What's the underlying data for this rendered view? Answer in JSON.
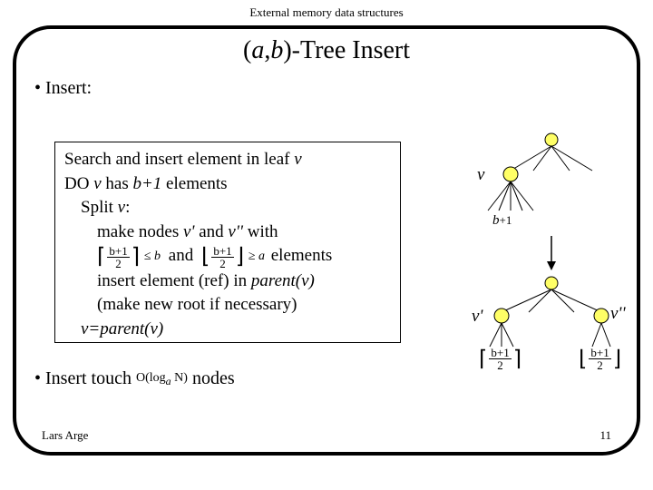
{
  "header": "External memory data structures",
  "title_pre": "(",
  "title_a": "a",
  "title_sep": ",",
  "title_b": "b",
  "title_post": ")-Tree Insert",
  "bullet_insert": "Insert:",
  "box": {
    "l1a": "Search and insert element in leaf ",
    "l1v": "v",
    "l2a": "DO ",
    "l2v": "v",
    "l2b": " has ",
    "l2c": "b+1",
    "l2d": " elements",
    "l3a": "Split ",
    "l3v": "v",
    "l3b": ":",
    "l4a": "make nodes ",
    "l4v1": "v'",
    "l4b": " and ",
    "l4v2": "v''",
    "l4c": " with",
    "l5_mid": "and",
    "l5_a": "a",
    "l5_b": "b",
    "l5_end": "elements",
    "frac_top": "b+1",
    "frac_bot": "2",
    "l6a": "insert element (ref) in ",
    "l6p": "parent(v)",
    "l7": "(make new root if necessary)",
    "l8": "v=parent(v)"
  },
  "touch_a": "Insert touch ",
  "touch_mid": "O(log",
  "touch_n": " N)",
  "touch_b": " nodes",
  "touch_sub": "a",
  "diagram": {
    "v": "v",
    "bp1_top": "b",
    "bp1_plus": "+1",
    "vprime": "v'",
    "vpp": "v''",
    "frac_top": "b+1",
    "frac_bot": "2"
  },
  "footer_left": "Lars Arge",
  "footer_right": "11"
}
